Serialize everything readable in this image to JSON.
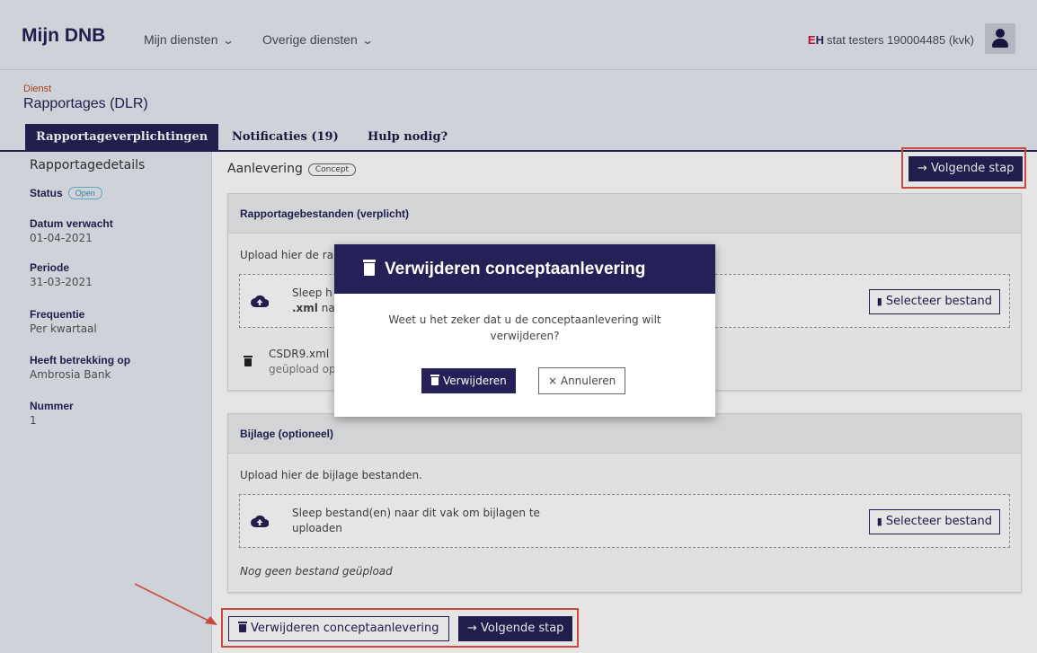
{
  "header": {
    "brand": "Mijn DNB",
    "nav": [
      "Mijn diensten",
      "Overige diensten"
    ],
    "org_logo_e": "E",
    "org_logo_h": "H",
    "org_name": "stat testers 190004485 (kvk)"
  },
  "service": {
    "label": "Dienst",
    "name": "Rapportages (DLR)"
  },
  "tabs": [
    "Rapportageverplichtingen",
    "Notificaties (19)",
    "Hulp nodig?"
  ],
  "sidebar": {
    "title": "Rapportagedetails",
    "status_label": "Status",
    "status_badge": "Open",
    "fields": [
      {
        "label": "Datum verwacht",
        "value": "01-04-2021"
      },
      {
        "label": "Periode",
        "value": "31-03-2021"
      },
      {
        "label": "Frequentie",
        "value": "Per kwartaal"
      },
      {
        "label": "Heeft betrekking op",
        "value": "Ambrosia Bank"
      },
      {
        "label": "Nummer",
        "value": "1"
      }
    ]
  },
  "main": {
    "title": "Aanlevering",
    "title_badge": "Concept",
    "next_button": "→ Volgende stap",
    "panel1": {
      "title": "Rapportagebestanden (verplicht)",
      "text": "Upload hier de ra",
      "drop_line1": "Sleep h",
      "drop_line2_bold": ".xml",
      "drop_line2": " na",
      "select_button": "Selecteer bestand",
      "file_name": "CSDR9.xml",
      "file_status": "geüpload op"
    },
    "panel2": {
      "title": "Bijlage (optioneel)",
      "text": "Upload hier de bijlage bestanden.",
      "drop_line1": "Sleep bestand(en) naar dit vak om bijlagen te",
      "drop_line2": "uploaden",
      "select_button": "Selecteer bestand",
      "empty": "Nog geen bestand geüpload"
    },
    "footer": {
      "delete_button": "Verwijderen conceptaanlevering",
      "next_button": "→ Volgende stap"
    }
  },
  "modal": {
    "title": "Verwijderen conceptaanlevering",
    "message": "Weet u het zeker dat u de conceptaanlevering wilt verwijderen?",
    "confirm": "Verwijderen",
    "cancel": "× Annuleren"
  },
  "colors": {
    "brand": "#252156",
    "highlight": "#e05246",
    "status_badge": "#3a8fb5"
  }
}
